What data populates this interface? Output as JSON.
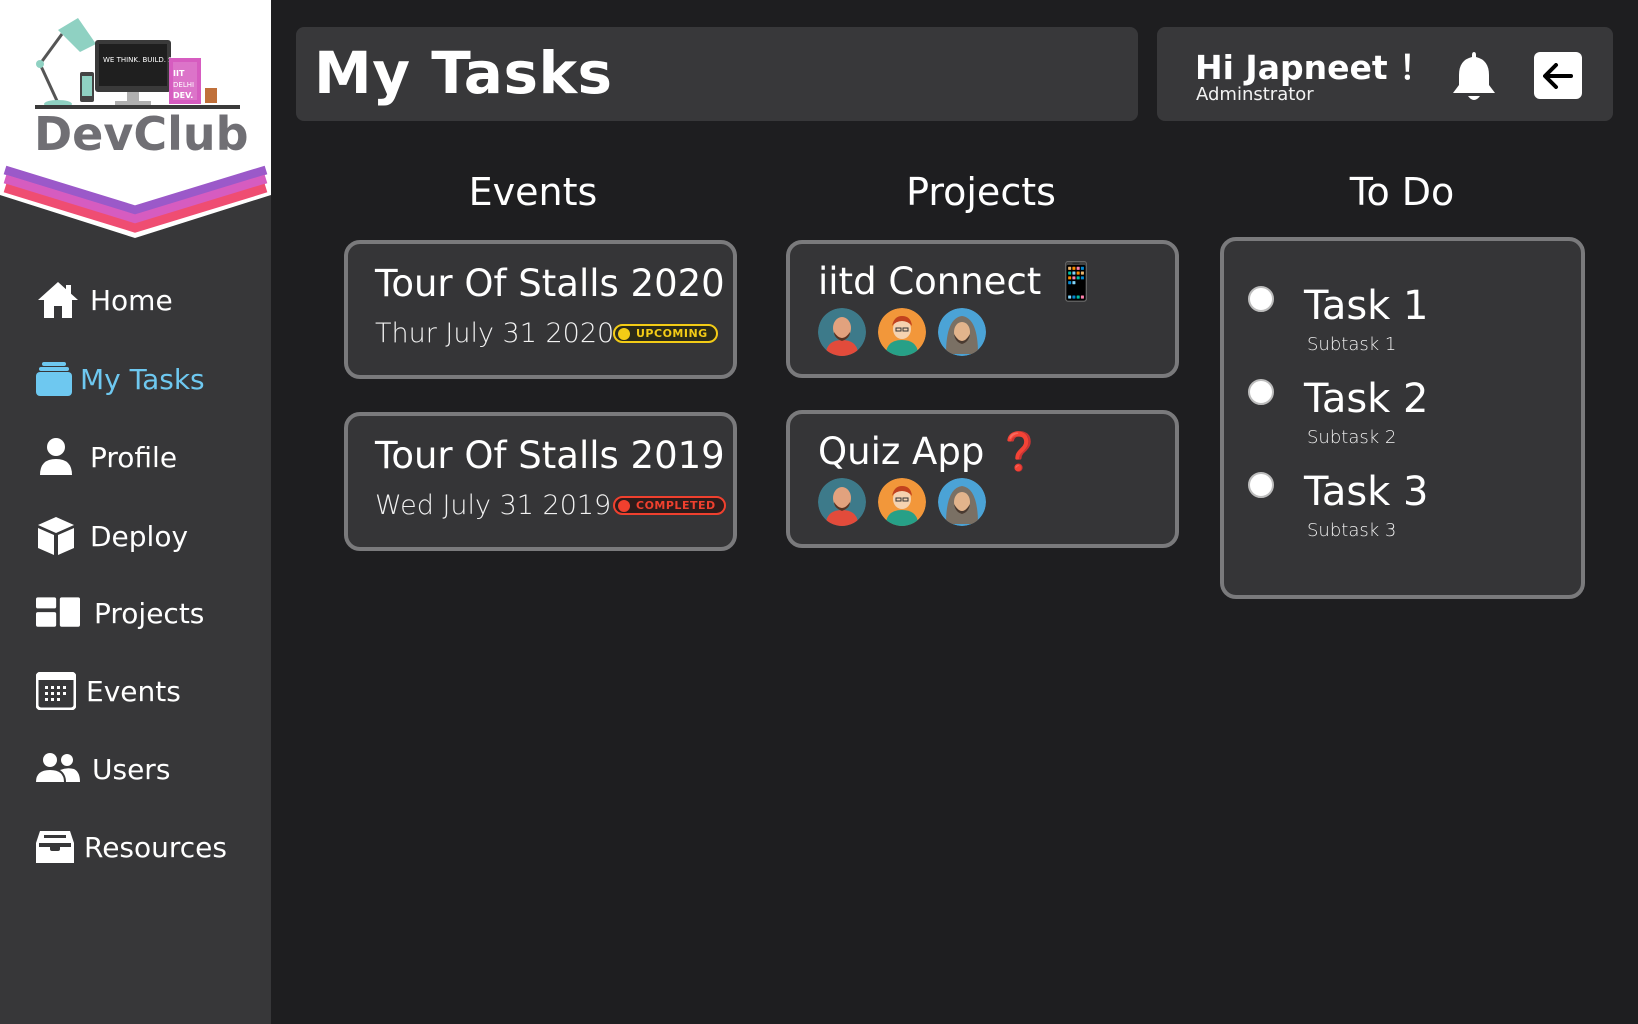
{
  "brand": {
    "logo_text": "DevClub",
    "logo_laptop_text": "WE THINK. BUILD. SOLVE.",
    "logo_book_text": "IIT DELHI DEV."
  },
  "sidebar": {
    "items": [
      {
        "label": "Home",
        "icon": "home-icon"
      },
      {
        "label": "My Tasks",
        "icon": "tasks-icon",
        "active": true
      },
      {
        "label": "Profile",
        "icon": "person-icon"
      },
      {
        "label": "Deploy",
        "icon": "box-icon"
      },
      {
        "label": "Projects",
        "icon": "dashboard-icon"
      },
      {
        "label": "Events",
        "icon": "calendar-icon"
      },
      {
        "label": "Users",
        "icon": "users-icon"
      },
      {
        "label": "Resources",
        "icon": "inbox-icon"
      }
    ],
    "active_color": "#6ec8f0"
  },
  "header": {
    "title": "My Tasks",
    "greeting": "Hi Japneet ！",
    "role": "Adminstrator"
  },
  "events": {
    "heading": "Events",
    "items": [
      {
        "title": "Tour Of Stalls 2020",
        "date": "Thur July 31 2020",
        "status": "UPCOMING",
        "status_color": "#f3cc16"
      },
      {
        "title": "Tour Of Stalls 2019",
        "date": "Wed July 31 2019",
        "status": "COMPLETED",
        "status_color": "#f0402e"
      }
    ]
  },
  "projects": {
    "heading": "Projects",
    "items": [
      {
        "title": "iitd Connect 📱",
        "members": [
          "avatar-bald-man",
          "avatar-red-hair",
          "avatar-hooded-man"
        ]
      },
      {
        "title": "Quiz App ❓",
        "members": [
          "avatar-bald-man",
          "avatar-red-hair",
          "avatar-hooded-man"
        ]
      }
    ]
  },
  "todo": {
    "heading": "To Do",
    "items": [
      {
        "title": "Task 1",
        "subtitle": "Subtask 1"
      },
      {
        "title": "Task 2",
        "subtitle": "Subtask 2"
      },
      {
        "title": "Task 3",
        "subtitle": "Subtask 3"
      }
    ]
  }
}
